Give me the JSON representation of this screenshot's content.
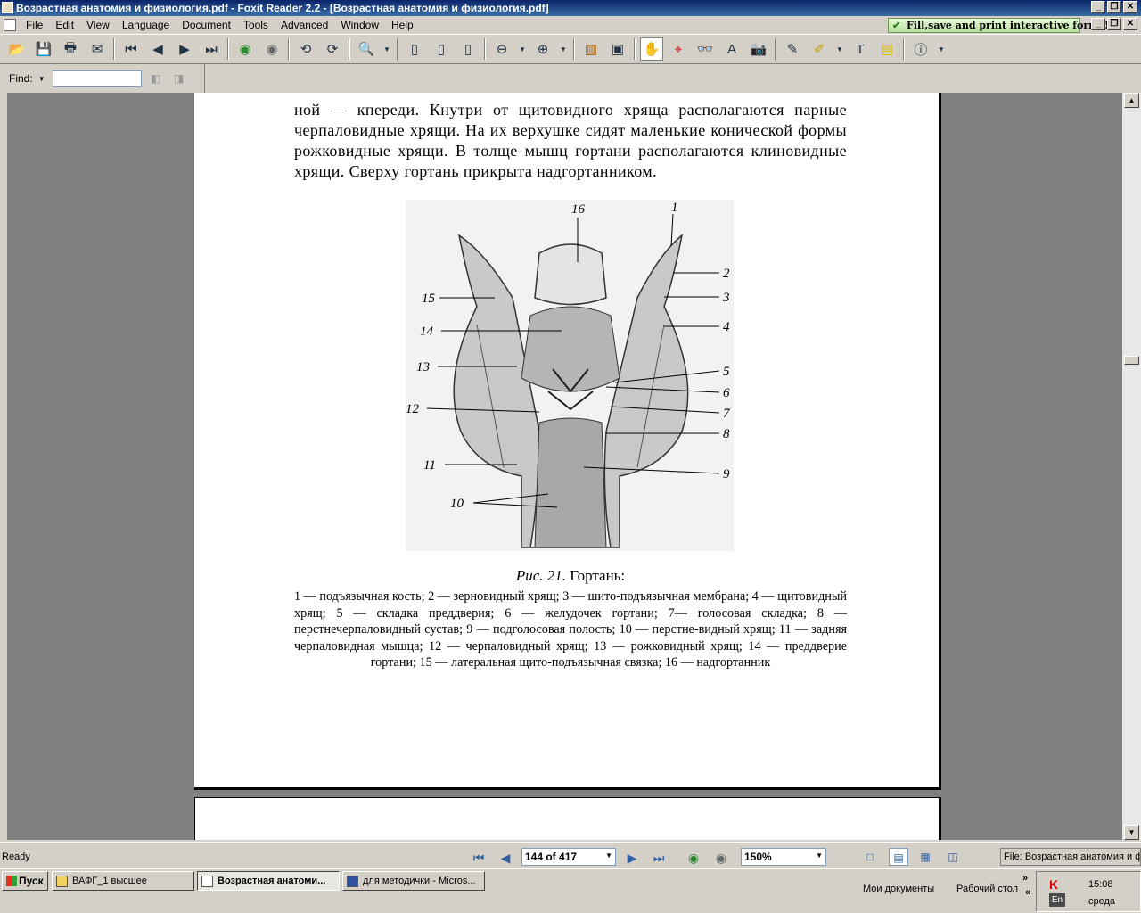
{
  "window": {
    "title": "Возрастная анатомия и физиология.pdf - Foxit Reader 2.2 - [Возрастная анатомия и физиология.pdf]"
  },
  "menu": [
    "File",
    "Edit",
    "View",
    "Language",
    "Document",
    "Tools",
    "Advanced",
    "Window",
    "Help"
  ],
  "banner": {
    "label": "Fill,save and print interactive forms!"
  },
  "find": {
    "label": "Find:",
    "value": ""
  },
  "document": {
    "body_text": "ной — кпереди. Кнутри от щитовидного хряща располагаются парные черпаловидные хрящи. На их верхушке сидят маленькие конической формы рожковидные хрящи. В толще мышц гортани располагаются клиновидные хрящи. Сверху гортань прикрыта надгортанником.",
    "figure_numbers": [
      "16",
      "1",
      "2",
      "3",
      "15",
      "4",
      "14",
      "13",
      "5",
      "6",
      "12",
      "7",
      "8",
      "11",
      "9",
      "10"
    ],
    "caption_fig": "Рис. 21.",
    "caption_title": "Гортань:",
    "caption_legend": "1 — подъязычная кость; 2 — зерновидный хрящ; 3 — шито-подъязычная мембрана; 4 — щитовидный хрящ; 5 — складка преддверия; 6 — желудочек гортани; 7— голосовая складка; 8 — перстнечерпаловидный сустав; 9 — подголосовая полость; 10 — перстне-видный хрящ; 11 — задняя черпаловидная мышца; 12 — черпаловидный хрящ; 13 — рожковидный хрящ; 14 — преддверие гортани; 15 — латеральная щито-подъязычная связка; 16 — надгортанник"
  },
  "status": {
    "ready": "Ready",
    "page": "144 of 417",
    "zoom": "150%",
    "file": "File: Возрастная анатомия и физиология.pdf"
  },
  "taskbar": {
    "start": "Пуск",
    "tasks": [
      "ВАФГ_1 высшее",
      "Возрастная анатоми...",
      "для методички - Micros..."
    ],
    "quick": [
      "Мои документы",
      "Рабочий стол"
    ],
    "time": "15:08",
    "day": "среда",
    "lang": "En"
  }
}
